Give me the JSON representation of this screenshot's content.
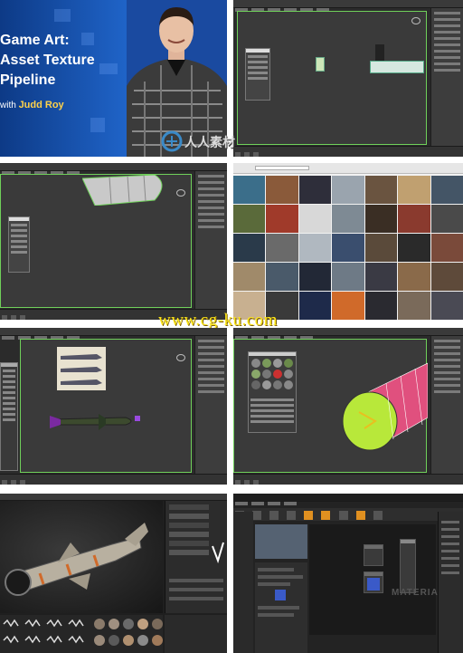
{
  "course": {
    "title_lines": [
      "Game Art:",
      "Asset Texture",
      "Pipeline"
    ],
    "byline_prefix": "with ",
    "author": "Judd Roy"
  },
  "watermark": "www.cg-ku.com",
  "material_label": "MATERIAL",
  "logo_text": "人人素材",
  "colors": {
    "title_bg": "#1f63c7",
    "accent_yellow": "#ffd24a",
    "viewport_border": "#6fd05a",
    "missile_pink": "#e0507e",
    "missile_green": "#b8e83a"
  },
  "panels": [
    {
      "id": "title-card",
      "content": "course-title"
    },
    {
      "id": "max-viewport-blockout",
      "content": "3ds-max"
    },
    {
      "id": "max-viewport-fuselage",
      "content": "3ds-max"
    },
    {
      "id": "reference-image-grid",
      "content": "browser"
    },
    {
      "id": "max-missile-lowpoly",
      "content": "3ds-max"
    },
    {
      "id": "max-missile-uv",
      "content": "3ds-max"
    },
    {
      "id": "painter-textured-missile",
      "content": "substance-painter"
    },
    {
      "id": "unreal-material-editor",
      "content": "unreal"
    }
  ]
}
